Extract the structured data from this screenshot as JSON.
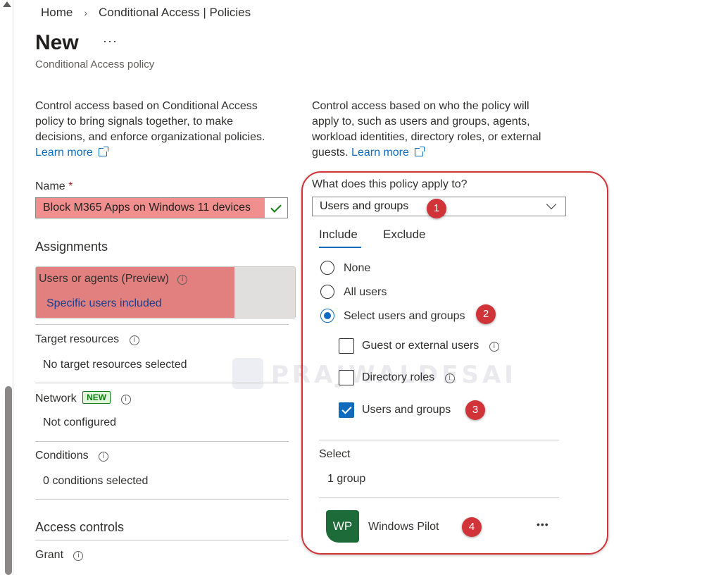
{
  "breadcrumb": {
    "home": "Home",
    "separator": "›",
    "current": "Conditional Access | Policies"
  },
  "header": {
    "title": "New",
    "more": "···",
    "subtitle": "Conditional Access policy"
  },
  "left": {
    "description": "Control access based on Conditional Access policy to bring signals together, to make decisions, and enforce organizational policies.",
    "learn_more": "Learn more",
    "name_label": "Name",
    "required_mark": "*",
    "name_value": "Block M365 Apps on Windows 11 devices",
    "assignments_heading": "Assignments",
    "users_label": "Users or agents (Preview)",
    "users_value": "Specific users included",
    "target_label": "Target resources",
    "target_value": "No target resources selected",
    "network_label": "Network",
    "network_badge": "NEW",
    "network_value": "Not configured",
    "conditions_label": "Conditions",
    "conditions_value": "0 conditions selected",
    "access_heading": "Access controls",
    "grant_label": "Grant",
    "info_glyph": "i"
  },
  "right": {
    "description": "Control access based on who the policy will apply to, such as users and groups, agents, workload identities, directory roles, or external guests.",
    "learn_more": "Learn more",
    "apply_label": "What does this policy apply to?",
    "apply_value": "Users and groups",
    "tabs": [
      {
        "label": "Include"
      },
      {
        "label": "Exclude"
      }
    ],
    "radios": [
      {
        "label": "None",
        "selected": false
      },
      {
        "label": "All users",
        "selected": false
      },
      {
        "label": "Select users and groups",
        "selected": true
      }
    ],
    "checkboxes": [
      {
        "label": "Guest or external users",
        "checked": false
      },
      {
        "label": "Directory roles",
        "checked": false
      },
      {
        "label": "Users and groups",
        "checked": true
      }
    ],
    "select_label": "Select",
    "select_value": "1 group",
    "group": {
      "initials": "WP",
      "name": "Windows Pilot",
      "more": "•••"
    }
  },
  "annotations": {
    "one": "1",
    "two": "2",
    "three": "3",
    "four": "4"
  },
  "watermark": "PRAJWALDESAI",
  "colors": {
    "accent": "#0f6cbd",
    "highlight": "#f18f8f",
    "annotation": "#d13438",
    "avatar": "#1e6b3a",
    "success": "#107c10"
  }
}
